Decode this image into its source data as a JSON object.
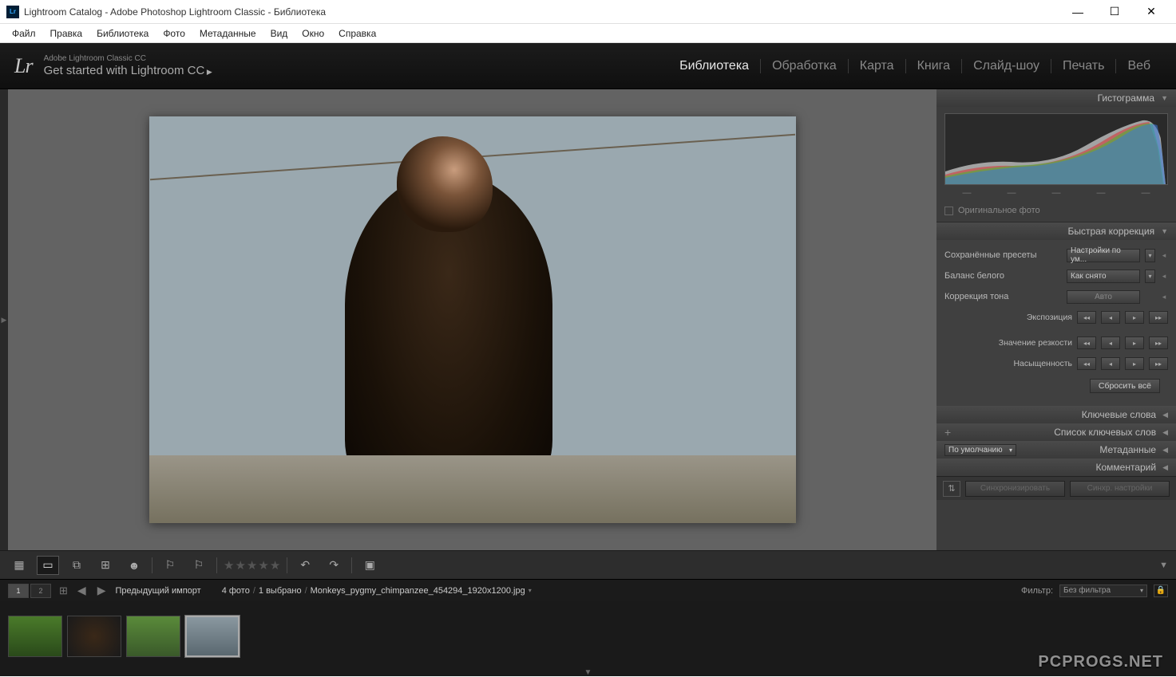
{
  "window": {
    "title": "Lightroom Catalog - Adobe Photoshop Lightroom Classic - Библиотека",
    "app_icon": "Lr"
  },
  "menubar": [
    "Файл",
    "Правка",
    "Библиотека",
    "Фото",
    "Метаданные",
    "Вид",
    "Окно",
    "Справка"
  ],
  "header": {
    "logo": "Lr",
    "tagline1": "Adobe Lightroom Classic CC",
    "tagline2": "Get started with Lightroom CC",
    "modules": [
      "Библиотека",
      "Обработка",
      "Карта",
      "Книга",
      "Слайд-шоу",
      "Печать",
      "Веб"
    ],
    "active_module": "Библиотека"
  },
  "right_panel": {
    "histogram_title": "Гистограмма",
    "original_photo_label": "Оригинальное фото",
    "quick_develop": {
      "title": "Быстрая коррекция",
      "rows": {
        "saved_presets_label": "Сохранённые пресеты",
        "saved_presets_value": "Настройки по ум...",
        "white_balance_label": "Баланс белого",
        "white_balance_value": "Как снято",
        "tone_correction_label": "Коррекция тона",
        "auto_label": "Авто",
        "exposure_label": "Экспозиция",
        "sharpen_label": "Значение резкости",
        "saturation_label": "Насыщенность",
        "reset_label": "Сбросить всё"
      }
    },
    "keywords_title": "Ключевые слова",
    "keyword_list_title": "Список ключевых слов",
    "metadata_title": "Метаданные",
    "metadata_dd": "По умолчанию",
    "comment_title": "Комментарий",
    "sync_label": "Синхронизировать",
    "sync_settings_label": "Синхр. настройки"
  },
  "filterbar": {
    "prev_import": "Предыдущий импорт",
    "count_photos": "4 фото",
    "count_selected": "1 выбрано",
    "filename": "Monkeys_pygmy_chimpanzee_454294_1920x1200.jpg",
    "filter_label": "Фильтр:",
    "filter_value": "Без фильтра"
  },
  "watermark": "PCPROGS.NET"
}
